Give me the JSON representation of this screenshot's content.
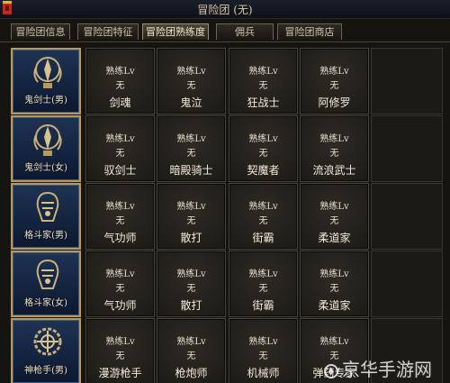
{
  "window": {
    "title": "冒险团 (无)"
  },
  "tabs": [
    {
      "label": "冒险团信息",
      "active": false
    },
    {
      "label": "冒险团特征",
      "active": false
    },
    {
      "label": "冒险团熟练度",
      "active": true
    },
    {
      "label": "佣兵",
      "active": false
    },
    {
      "label": "冒险团商店",
      "active": false
    }
  ],
  "help": {
    "icon": "question-icon",
    "label": "?"
  },
  "rows": [
    {
      "class": {
        "name": "鬼剑士(男)",
        "icon": "swordsman-emblem-icon"
      },
      "skills": [
        {
          "prof": "熟练Lv",
          "level": "无",
          "name": "剑魂"
        },
        {
          "prof": "熟练Lv",
          "level": "无",
          "name": "鬼泣"
        },
        {
          "prof": "熟练Lv",
          "level": "无",
          "name": "狂战士"
        },
        {
          "prof": "熟练Lv",
          "level": "无",
          "name": "阿修罗"
        }
      ]
    },
    {
      "class": {
        "name": "鬼剑士(女)",
        "icon": "swordsman-emblem-icon"
      },
      "skills": [
        {
          "prof": "熟练Lv",
          "level": "无",
          "name": "驭剑士"
        },
        {
          "prof": "熟练Lv",
          "level": "无",
          "name": "暗殿骑士"
        },
        {
          "prof": "熟练Lv",
          "level": "无",
          "name": "契魔者"
        },
        {
          "prof": "熟练Lv",
          "level": "无",
          "name": "流浪武士"
        }
      ]
    },
    {
      "class": {
        "name": "格斗家(男)",
        "icon": "fighter-emblem-icon"
      },
      "skills": [
        {
          "prof": "熟练Lv",
          "level": "无",
          "name": "气功师"
        },
        {
          "prof": "熟练Lv",
          "level": "无",
          "name": "散打"
        },
        {
          "prof": "熟练Lv",
          "level": "无",
          "name": "街霸"
        },
        {
          "prof": "熟练Lv",
          "level": "无",
          "name": "柔道家"
        }
      ]
    },
    {
      "class": {
        "name": "格斗家(女)",
        "icon": "fighter-emblem-icon"
      },
      "skills": [
        {
          "prof": "熟练Lv",
          "level": "无",
          "name": "气功师"
        },
        {
          "prof": "熟练Lv",
          "level": "无",
          "name": "散打"
        },
        {
          "prof": "熟练Lv",
          "level": "无",
          "name": "街霸"
        },
        {
          "prof": "熟练Lv",
          "level": "无",
          "name": "柔道家"
        }
      ]
    },
    {
      "class": {
        "name": "神枪手(男)",
        "icon": "gunner-emblem-icon"
      },
      "skills": [
        {
          "prof": "熟练Lv",
          "level": "无",
          "name": "漫游枪手"
        },
        {
          "prof": "熟练Lv",
          "level": "无",
          "name": "枪炮师"
        },
        {
          "prof": "熟练Lv",
          "level": "无",
          "name": "机械师"
        },
        {
          "prof": "熟练Lv",
          "level": "无",
          "name": "弹药专家"
        }
      ]
    }
  ],
  "watermark": {
    "text": "京华手游网",
    "icon": "site-logo-icon"
  },
  "colors": {
    "gold": "#b99a55",
    "class_bg": "#1e3353",
    "help": "#d7a11c"
  }
}
